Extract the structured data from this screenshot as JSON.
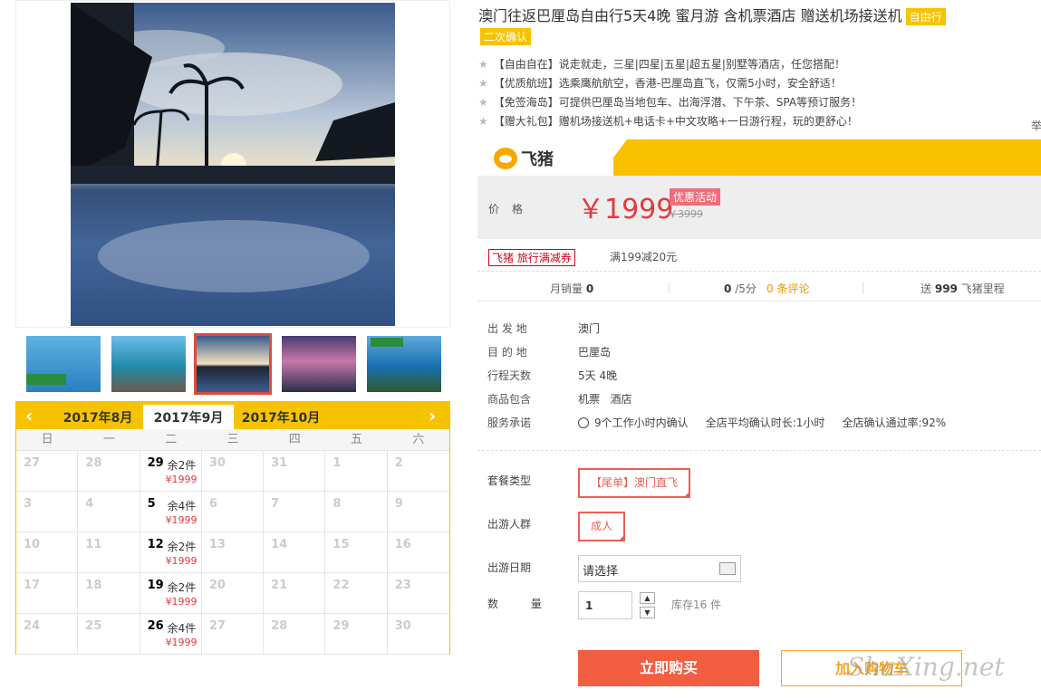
{
  "product": {
    "title": "澳门往返巴厘岛自由行5天4晚 蜜月游 含机票酒店 赠送机场接送机",
    "type_tag": "自由行",
    "confirm_tag": "二次确认",
    "features": [
      "【自由自在】说走就走，三星|四星|五星|超五星|别墅等酒店，任您搭配！",
      "【优质航班】选乘鹰航航空，香港-巴厘岛直飞，仅需5小时，安全舒适！",
      "【免签海岛】可提供巴厘岛当地包车、出海浮潜、下午茶、SPA等预订服务！",
      "【赠大礼包】赠机场接送机+电话卡+中文攻略+一日游行程，玩的更舒心！"
    ],
    "report_link": "举"
  },
  "brand": {
    "name": "飞猪",
    "icon": "fliggy-pig-icon"
  },
  "price": {
    "label": "价格",
    "current": "￥1999",
    "promo_tag": "优惠活动",
    "original": "￥3999"
  },
  "coupon": {
    "tag": "飞猪 旅行满减券",
    "text": "满199减20元"
  },
  "stats": {
    "monthly_sales_label": "月销量",
    "monthly_sales": "0",
    "rating": "0",
    "rating_suffix": "/5分",
    "reviews": "0 条评论",
    "miles_prefix": "送",
    "miles": "999",
    "miles_suffix": "飞猪里程"
  },
  "info": [
    {
      "k": "出 发 地",
      "v": "澳门"
    },
    {
      "k": "目 的 地",
      "v": "巴厘岛"
    },
    {
      "k": "行程天数",
      "v": "5天 4晚"
    },
    {
      "k": "商品包含",
      "v": "机票   酒店"
    },
    {
      "k": "服务承诺",
      "v": "9个工作小时内确认     全店平均确认时长:1小时     全店确认通过率:92%"
    }
  ],
  "options": {
    "package_label": "套餐类型",
    "package_value": "【尾单】澳门直飞",
    "traveler_label": "出游人群",
    "traveler_value": "成人",
    "date_label": "出游日期",
    "date_placeholder": "请选择",
    "qty_label": "数 量",
    "qty_value": "1",
    "stock": "库存16 件"
  },
  "buttons": {
    "buy": "立即购买",
    "cart": "加入购物车"
  },
  "watermark": "ShaXing.net",
  "calendar": {
    "months": [
      "2017年8月",
      "2017年9月",
      "2017年10月"
    ],
    "active_month": "2017年9月",
    "weekdays": [
      "日",
      "一",
      "二",
      "三",
      "四",
      "五",
      "六"
    ],
    "cells": [
      {
        "d": "27"
      },
      {
        "d": "28"
      },
      {
        "d": "29",
        "stock": "余2件",
        "price": "¥1999"
      },
      {
        "d": "30"
      },
      {
        "d": "31"
      },
      {
        "d": "1"
      },
      {
        "d": "2"
      },
      {
        "d": "3"
      },
      {
        "d": "4"
      },
      {
        "d": "5",
        "stock": "余4件",
        "price": "¥1999"
      },
      {
        "d": "6"
      },
      {
        "d": "7"
      },
      {
        "d": "8"
      },
      {
        "d": "9"
      },
      {
        "d": "10"
      },
      {
        "d": "11"
      },
      {
        "d": "12",
        "stock": "余2件",
        "price": "¥1999"
      },
      {
        "d": "13"
      },
      {
        "d": "14"
      },
      {
        "d": "15"
      },
      {
        "d": "16"
      },
      {
        "d": "17"
      },
      {
        "d": "18"
      },
      {
        "d": "19",
        "stock": "余2件",
        "price": "¥1999"
      },
      {
        "d": "20"
      },
      {
        "d": "21"
      },
      {
        "d": "22"
      },
      {
        "d": "23"
      },
      {
        "d": "24"
      },
      {
        "d": "25"
      },
      {
        "d": "26",
        "stock": "余4件",
        "price": "¥1999"
      },
      {
        "d": "27"
      },
      {
        "d": "28"
      },
      {
        "d": "29"
      },
      {
        "d": "30"
      }
    ]
  },
  "colors": {
    "accent": "#f7c300",
    "price_red": "#e4393c",
    "buy": "#f35d40"
  }
}
